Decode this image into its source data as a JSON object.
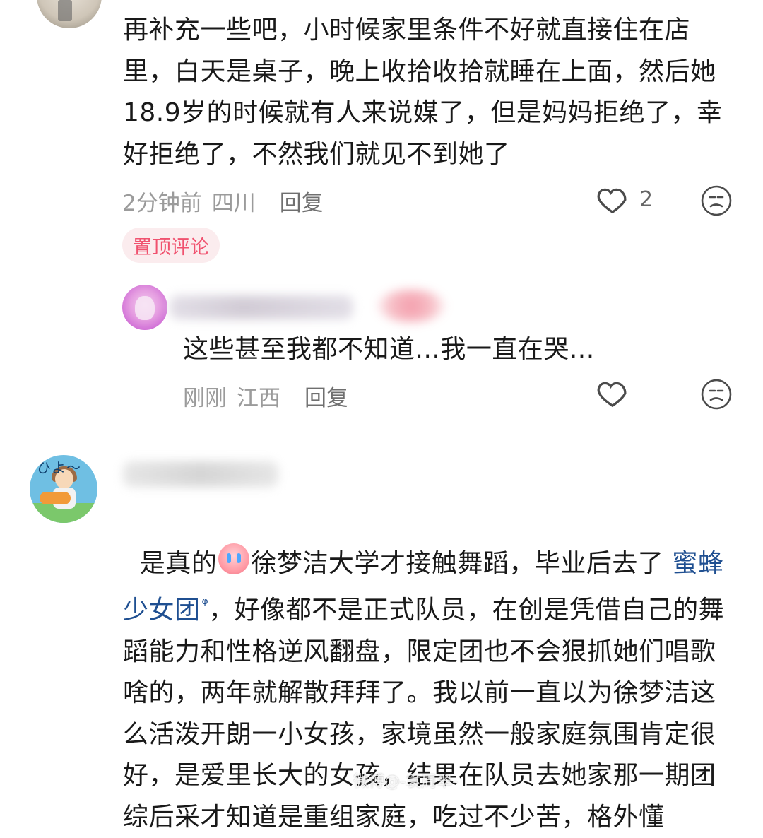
{
  "comments": {
    "top": {
      "text": "再补充一些吧，小时候家里条件不好就直接住在店里，白天是桌子，晚上收拾收拾就睡在上面，然后她18.9岁的时候就有人来说媒了，但是妈妈拒绝了，幸好拒绝了，不然我们就见不到她了",
      "time": "2分钟前",
      "location": "四川",
      "reply_label": "回复",
      "like_count": "2",
      "badge": "置顶评论"
    },
    "reply": {
      "text": "这些甚至我都不知道...我一直在哭...",
      "time": "刚刚",
      "location": "江西",
      "reply_label": "回复"
    },
    "second": {
      "avatar_text": "ひよ〜",
      "text_line_1a": "是真的",
      "text_line_1b": "徐梦洁大学才接触舞蹈，毕业后去了 ",
      "link_text": "蜜蜂少女团",
      "text_line_2": "，好像都不是正式队员，在创是凭借自己的舞蹈能力和性格逆风翻盘，限定团也不会狠抓她们唱歌啥的，两年就解散拜拜了。我以前一直以为徐梦洁这么活泼开朗一小女孩，家境虽然一般家庭氛围肯定很好，是爱里长大的女孩，结果在队员去她家那一期团综后采才知道是重组家庭，吃过不少苦，格外懂"
    }
  },
  "watermark": "微博@-袁周翠-"
}
